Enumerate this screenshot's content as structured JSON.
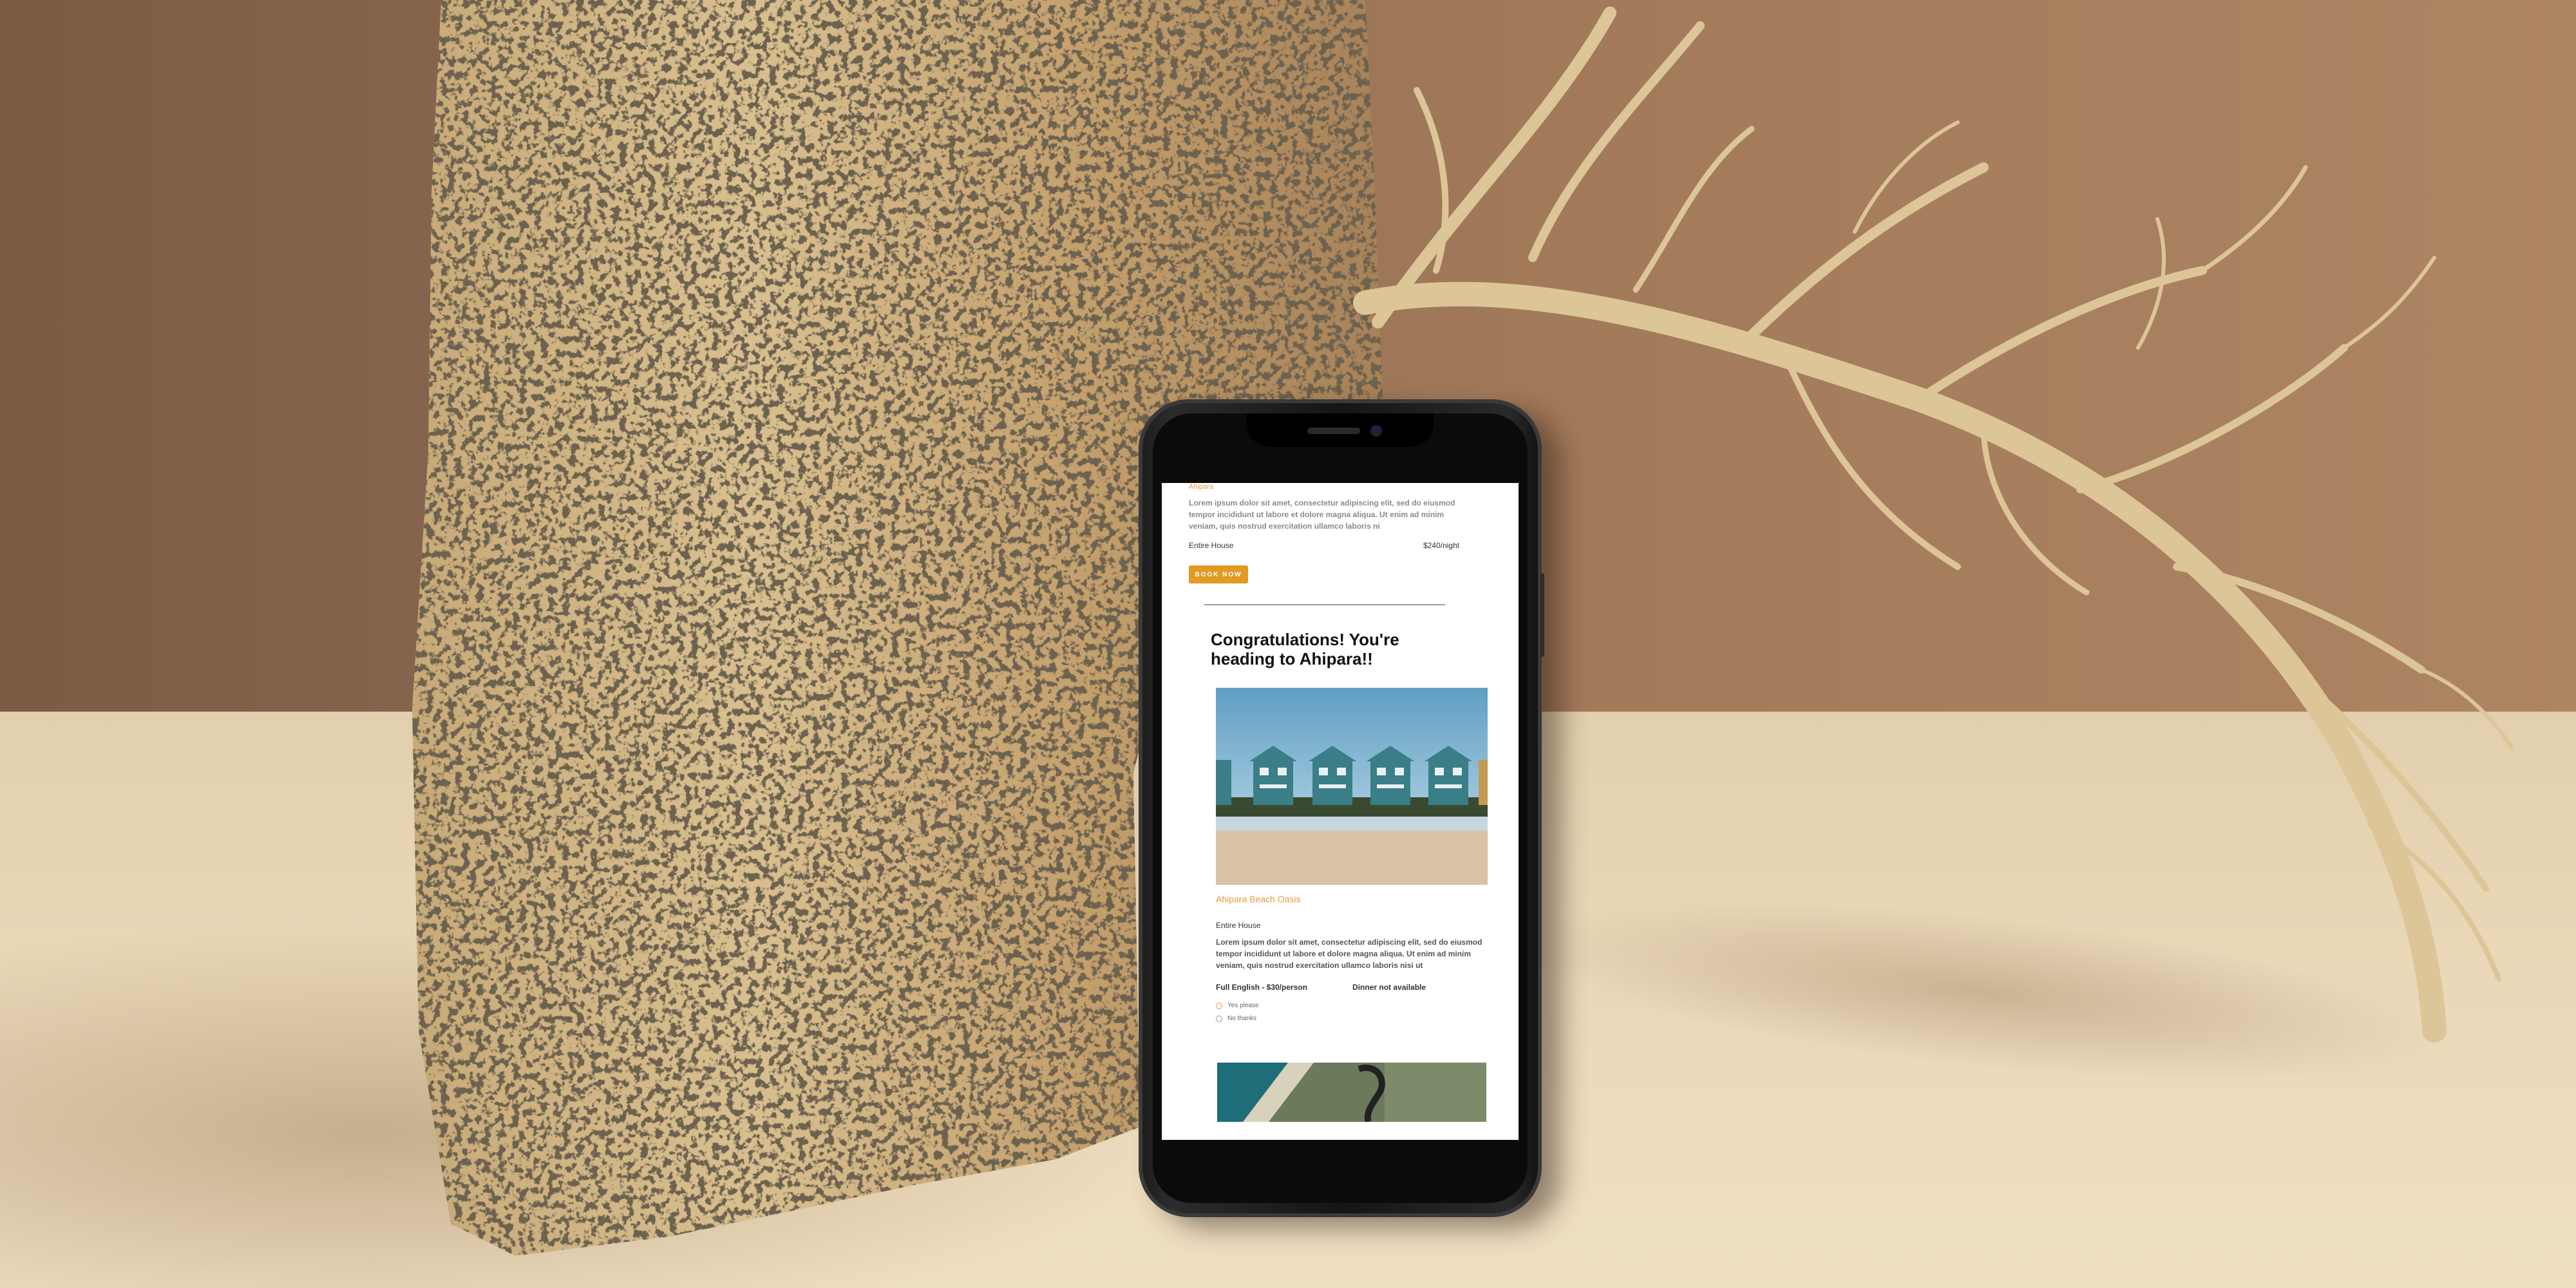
{
  "email": {
    "top_listing": {
      "area": "Ahipara",
      "description": "Lorem ipsum dolor sit amet, consectetur adipiscing elit, sed do eiusmod tempor incididunt ut labore et dolore magna aliqua. Ut enim ad minim veniam, quis nostrud exercitation ullamco laboris ni",
      "type": "Entire House",
      "price": "$240/night",
      "book_label": "BOOK NOW"
    },
    "heading": "Congratulations! You're heading to Ahipara!!",
    "property": {
      "name": "Ahipara Beach Oasis",
      "type": "Entire House",
      "description": "Lorem ipsum dolor sit amet, consectetur adipiscing elit, sed do eiusmod tempor incididunt ut labore et dolore magna aliqua. Ut enim ad minim veniam, quis nostrud exercitation ullamco laboris nisi ut",
      "breakfast": "Full English - $30/person",
      "dinner": "Dinner not available",
      "options": [
        {
          "label": "Yes please",
          "selected": true
        },
        {
          "label": "No thanks",
          "selected": false
        }
      ]
    },
    "accent_color": "#e39a22",
    "link_color": "#e69a3c"
  }
}
